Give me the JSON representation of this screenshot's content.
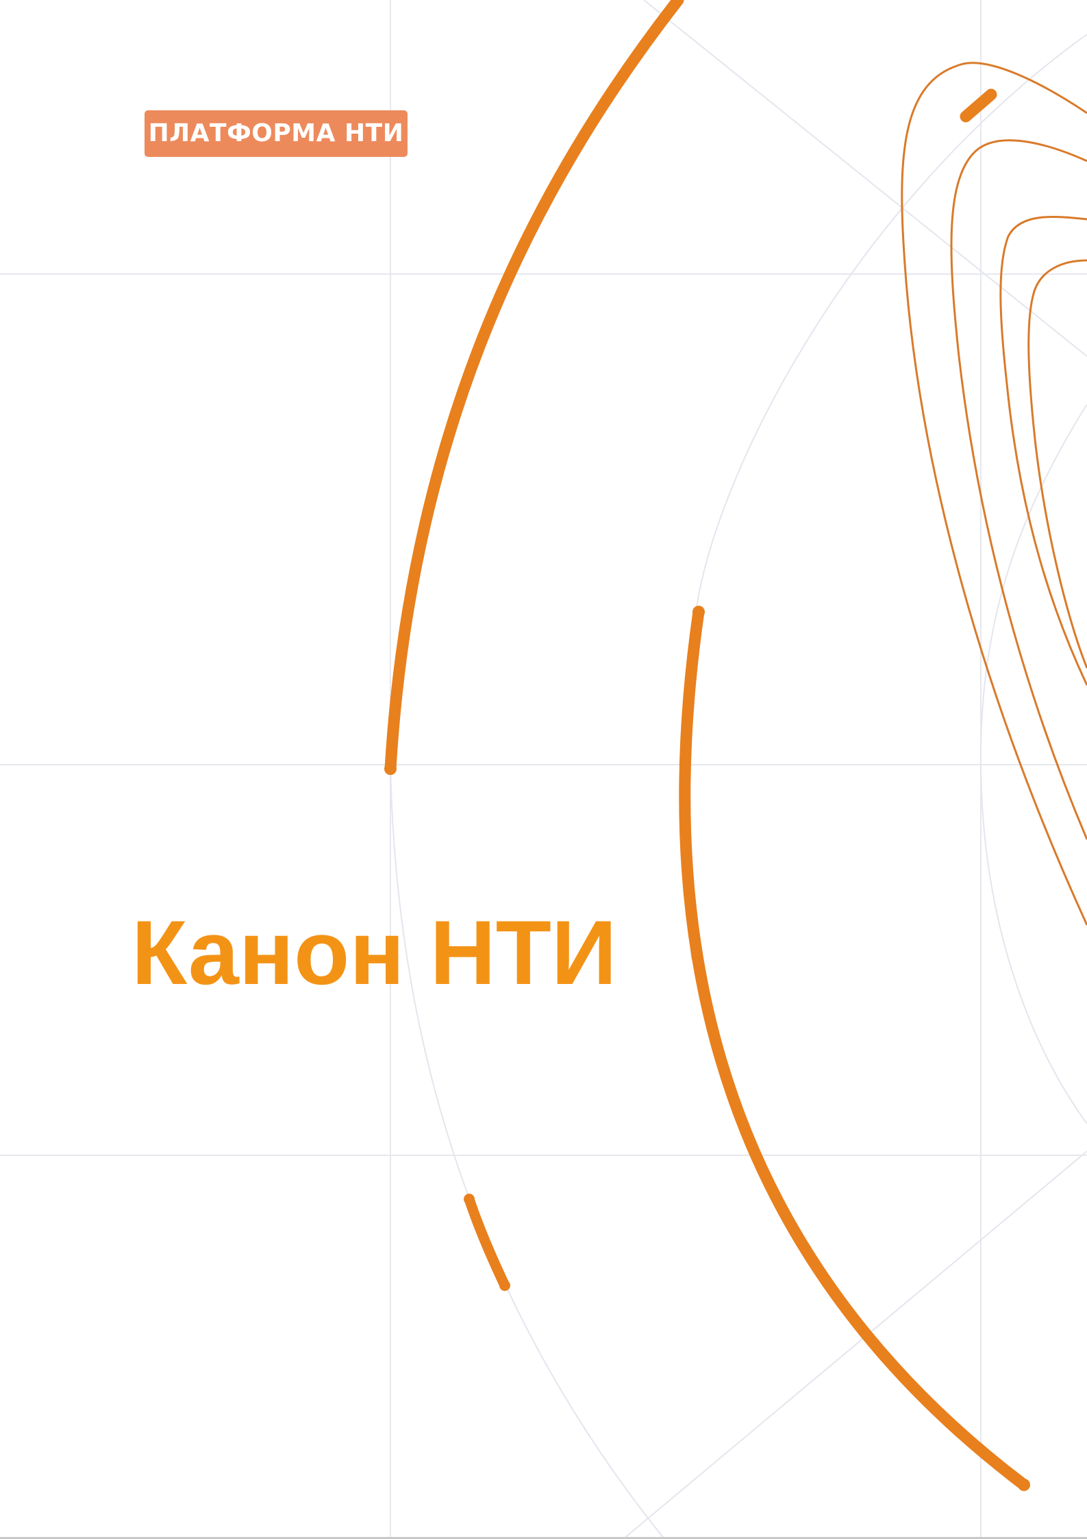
{
  "brand": {
    "badge_text": "ПЛАТФОРМА НТИ"
  },
  "title": "Канон НТИ",
  "colors": {
    "accent_orange": "#e8801e",
    "title_orange": "#f39316",
    "badge_fill": "#ed8a5c",
    "grid_line": "#e6e8ee"
  }
}
